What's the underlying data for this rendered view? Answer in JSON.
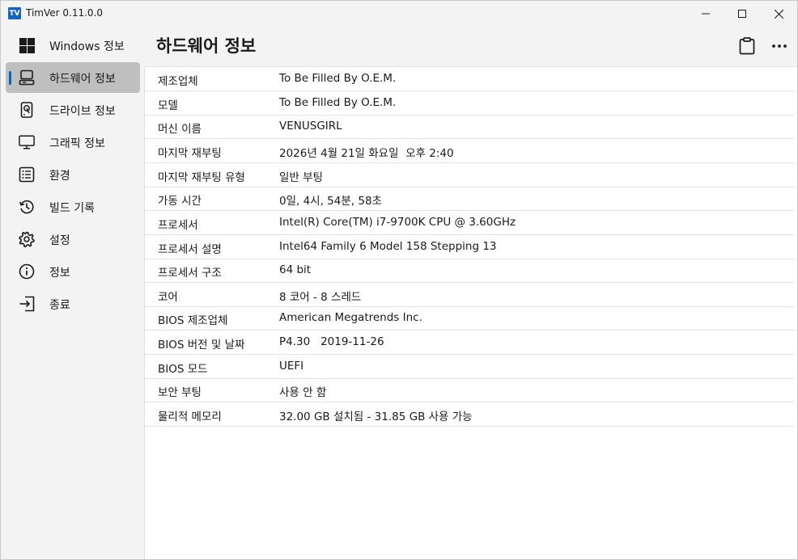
{
  "window": {
    "logo": "TV",
    "title": "TimVer  0.11.0.0"
  },
  "sidebar": {
    "items": [
      {
        "label": "Windows 정보",
        "icon": "windows-logo-icon"
      },
      {
        "label": "하드웨어 정보",
        "icon": "computer-icon",
        "selected": true
      },
      {
        "label": "드라이브 정보",
        "icon": "hard-drive-icon"
      },
      {
        "label": "그래픽 정보",
        "icon": "monitor-icon"
      },
      {
        "label": "환경",
        "icon": "list-icon"
      },
      {
        "label": "빌드 기록",
        "icon": "history-icon"
      },
      {
        "label": "설정",
        "icon": "gear-icon"
      },
      {
        "label": "정보",
        "icon": "info-icon"
      },
      {
        "label": "종료",
        "icon": "exit-icon"
      }
    ]
  },
  "main": {
    "title": "하드웨어 정보",
    "rows": [
      {
        "key": "제조업체",
        "value": "To Be Filled By O.E.M."
      },
      {
        "key": "모델",
        "value": "To Be Filled By O.E.M."
      },
      {
        "key": "머신 이름",
        "value": "VENUSGIRL"
      },
      {
        "key": "마지막 재부팅",
        "value": "2026년 4월 21일 화요일  오후 2:40"
      },
      {
        "key": "마지막 재부팅 유형",
        "value": "일반 부팅"
      },
      {
        "key": "가동 시간",
        "value": "0일, 4시, 54분, 58초"
      },
      {
        "key": "프로세서",
        "value": "Intel(R) Core(TM) i7-9700K CPU @ 3.60GHz"
      },
      {
        "key": "프로세서 설명",
        "value": "Intel64 Family 6 Model 158 Stepping 13"
      },
      {
        "key": "프로세서 구조",
        "value": "64 bit"
      },
      {
        "key": "코어",
        "value": "8 코어 - 8 스레드"
      },
      {
        "key": "BIOS 제조업체",
        "value": "American Megatrends Inc."
      },
      {
        "key": "BIOS 버전 및 날짜",
        "value": "P4.30   2019-11-26"
      },
      {
        "key": "BIOS 모드",
        "value": "UEFI"
      },
      {
        "key": "보안 부팅",
        "value": "사용 안 함"
      },
      {
        "key": "물리적 메모리",
        "value": "32.00 GB 설치됨 - 31.85 GB 사용 가능"
      }
    ]
  },
  "colors": {
    "accent": "#0067c0",
    "selected_bg": "#bfbfbf",
    "window_bg": "#f3f3f3",
    "content_bg": "#ffffff"
  }
}
